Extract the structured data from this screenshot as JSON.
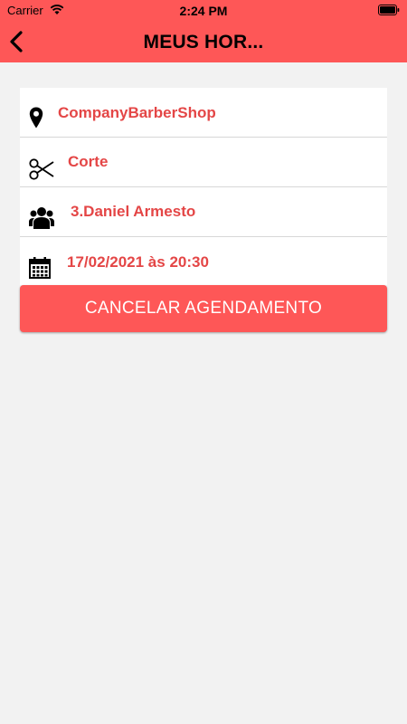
{
  "status_bar": {
    "carrier": "Carrier",
    "time": "2:24 PM",
    "wifi_icon": "wifi-icon",
    "battery_icon": "battery-icon"
  },
  "header": {
    "title": "MEUS HOR...",
    "back_icon": "chevron-left-icon",
    "background": "#fe5757"
  },
  "details": {
    "items": [
      {
        "icon": "location-pin-icon",
        "value": "CompanyBarberShop"
      },
      {
        "icon": "scissors-icon",
        "value": "Corte"
      },
      {
        "icon": "users-icon",
        "value": "3.Daniel Armesto"
      },
      {
        "icon": "calendar-icon",
        "value": "17/02/2021 às 20:30"
      }
    ],
    "text_color": "#e44646"
  },
  "actions": {
    "cancel_label": "CANCELAR AGENDAMENTO"
  },
  "colors": {
    "accent": "#fe5757",
    "background": "#f2f2f2",
    "card": "#ffffff"
  }
}
